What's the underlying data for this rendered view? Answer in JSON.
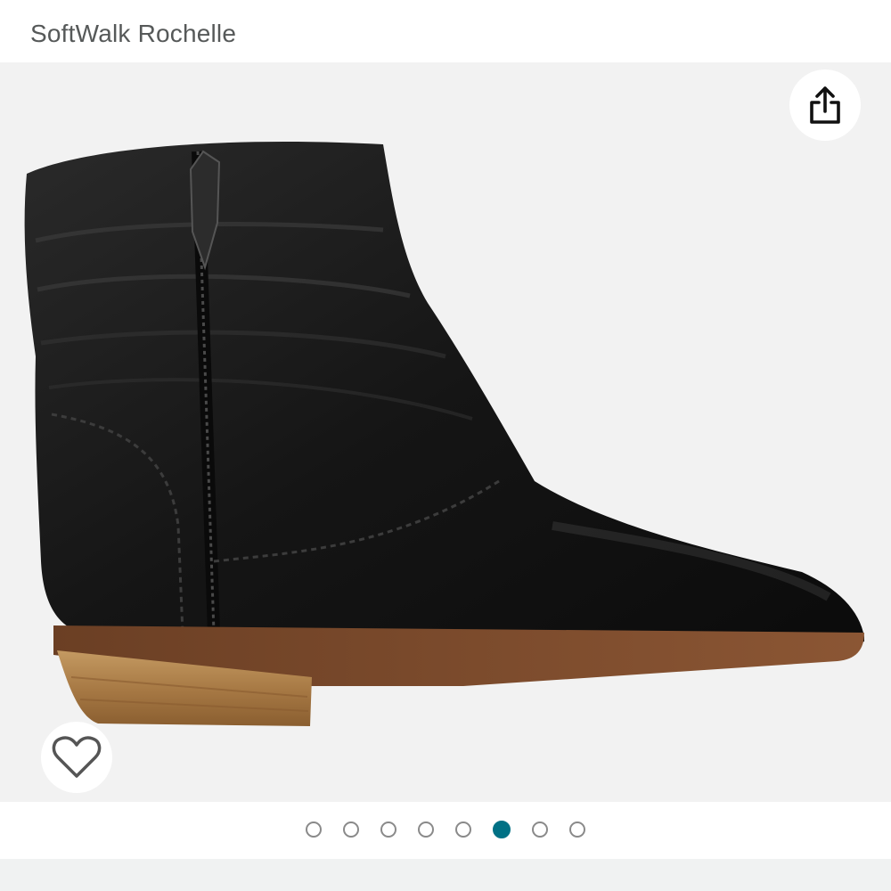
{
  "product": {
    "title": "SoftWalk Rochelle"
  },
  "image": {
    "subject": "black leather ankle boot",
    "background_color": "#f2f2f2"
  },
  "actions": {
    "share_icon": "share-icon",
    "wishlist_icon": "heart-outline-icon"
  },
  "carousel": {
    "total": 8,
    "active_index": 5,
    "active_color": "#007185",
    "inactive_color": "#8a8a8a"
  }
}
